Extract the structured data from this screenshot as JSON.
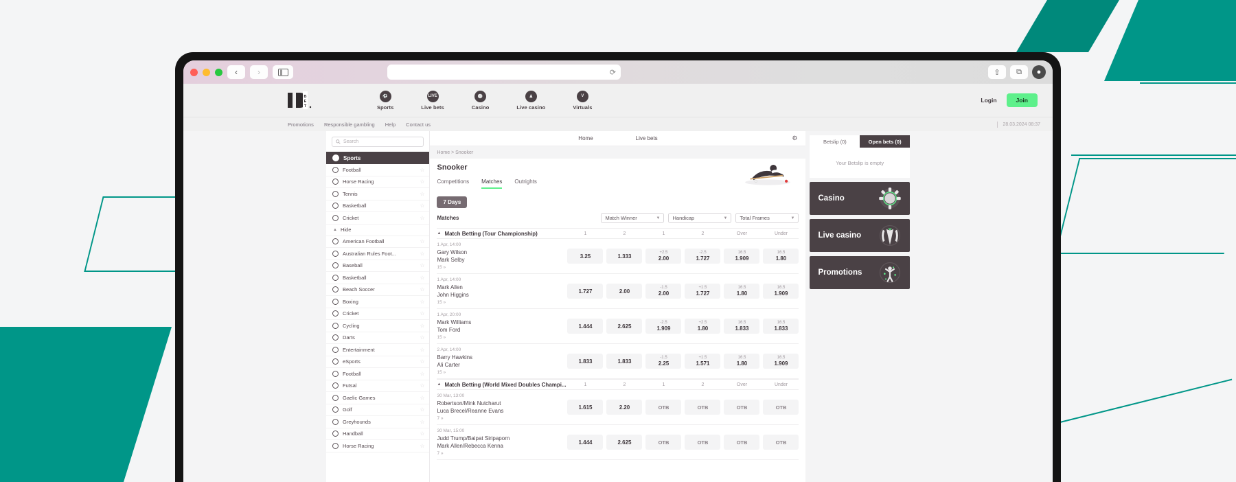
{
  "browser": {
    "back_icon": "‹",
    "forward_icon": "›",
    "sidebar_icon": "sidebar-icon",
    "reload_icon": "⟳",
    "share_icon": "⇧",
    "tabs_icon": "⧉",
    "profile_icon": "●"
  },
  "header": {
    "logo_text": "10BET",
    "nav": [
      {
        "label": "Sports",
        "icon": "football-icon"
      },
      {
        "label": "Live bets",
        "icon": "live-icon"
      },
      {
        "label": "Casino",
        "icon": "chip-icon"
      },
      {
        "label": "Live casino",
        "icon": "dealer-icon"
      },
      {
        "label": "Virtuals",
        "icon": "virtuals-icon"
      }
    ],
    "login_label": "Login",
    "join_label": "Join"
  },
  "subnav": {
    "links": [
      "Promotions",
      "Responsible gambling",
      "Help",
      "Contact us"
    ],
    "datetime": "28.03.2024 08:37"
  },
  "sidebar": {
    "search_placeholder": "Search",
    "section_title": "Sports",
    "top_items": [
      {
        "label": "Football",
        "icon": "football-icon"
      },
      {
        "label": "Horse Racing",
        "icon": "horse-icon"
      },
      {
        "label": "Tennis",
        "icon": "tennis-icon"
      },
      {
        "label": "Basketball",
        "icon": "basketball-icon"
      },
      {
        "label": "Cricket",
        "icon": "cricket-icon"
      }
    ],
    "hide_label": "Hide",
    "all_items": [
      {
        "label": "American Football",
        "icon": "american-football-icon"
      },
      {
        "label": "Australian Rules Foot...",
        "icon": "aussie-rules-icon"
      },
      {
        "label": "Baseball",
        "icon": "baseball-icon"
      },
      {
        "label": "Basketball",
        "icon": "basketball-icon"
      },
      {
        "label": "Beach Soccer",
        "icon": "beach-soccer-icon"
      },
      {
        "label": "Boxing",
        "icon": "boxing-icon"
      },
      {
        "label": "Cricket",
        "icon": "cricket-icon"
      },
      {
        "label": "Cycling",
        "icon": "cycling-icon"
      },
      {
        "label": "Darts",
        "icon": "darts-icon"
      },
      {
        "label": "Entertainment",
        "icon": "tv-icon"
      },
      {
        "label": "eSports",
        "icon": "esports-icon"
      },
      {
        "label": "Football",
        "icon": "football-icon"
      },
      {
        "label": "Futsal",
        "icon": "futsal-icon"
      },
      {
        "label": "Gaelic Games",
        "icon": "gaelic-icon"
      },
      {
        "label": "Golf",
        "icon": "golf-icon"
      },
      {
        "label": "Greyhounds",
        "icon": "greyhound-icon"
      },
      {
        "label": "Handball",
        "icon": "handball-icon"
      },
      {
        "label": "Horse Racing",
        "icon": "horse-icon"
      }
    ],
    "star_icon": "☆"
  },
  "main": {
    "top_tabs": [
      "Home",
      "Live bets"
    ],
    "settings_icon": "gear-icon",
    "breadcrumb": "Home > Snooker",
    "page_title": "Snooker",
    "tabs": [
      {
        "label": "Competitions",
        "active": false
      },
      {
        "label": "Matches",
        "active": true
      },
      {
        "label": "Outrights",
        "active": false
      }
    ],
    "days_filter": "7 Days",
    "matches_label": "Matches",
    "market_selects": [
      "Match Winner",
      "Handicap",
      "Total Frames"
    ],
    "groups": [
      {
        "name": "Match Betting (Tour Championship)",
        "col_headers": [
          "1",
          "2",
          "1",
          "2",
          "Over",
          "Under"
        ],
        "matches": [
          {
            "time": "1 Apr, 14:00",
            "home": "Gary Wilson",
            "away": "Mark Selby",
            "more": "15 »",
            "odds": [
              {
                "hcp": "",
                "val": "3.25"
              },
              {
                "hcp": "",
                "val": "1.333"
              },
              {
                "hcp": "+2.5",
                "val": "2.00"
              },
              {
                "hcp": "-2.5",
                "val": "1.727"
              },
              {
                "hcp": "16.5",
                "val": "1.909"
              },
              {
                "hcp": "16.5",
                "val": "1.80"
              }
            ]
          },
          {
            "time": "1 Apr, 14:00",
            "home": "Mark Allen",
            "away": "John Higgins",
            "more": "15 »",
            "odds": [
              {
                "hcp": "",
                "val": "1.727"
              },
              {
                "hcp": "",
                "val": "2.00"
              },
              {
                "hcp": "-1.5",
                "val": "2.00"
              },
              {
                "hcp": "+1.5",
                "val": "1.727"
              },
              {
                "hcp": "16.5",
                "val": "1.80"
              },
              {
                "hcp": "16.5",
                "val": "1.909"
              }
            ]
          },
          {
            "time": "1 Apr, 20:00",
            "home": "Mark Williams",
            "away": "Tom Ford",
            "more": "15 »",
            "odds": [
              {
                "hcp": "",
                "val": "1.444"
              },
              {
                "hcp": "",
                "val": "2.625"
              },
              {
                "hcp": "-2.5",
                "val": "1.909"
              },
              {
                "hcp": "+2.5",
                "val": "1.80"
              },
              {
                "hcp": "16.5",
                "val": "1.833"
              },
              {
                "hcp": "16.5",
                "val": "1.833"
              }
            ]
          },
          {
            "time": "2 Apr, 14:00",
            "home": "Barry Hawkins",
            "away": "Ali Carter",
            "more": "15 »",
            "odds": [
              {
                "hcp": "",
                "val": "1.833"
              },
              {
                "hcp": "",
                "val": "1.833"
              },
              {
                "hcp": "-1.5",
                "val": "2.25"
              },
              {
                "hcp": "+1.5",
                "val": "1.571"
              },
              {
                "hcp": "16.5",
                "val": "1.80"
              },
              {
                "hcp": "16.5",
                "val": "1.909"
              }
            ]
          }
        ]
      },
      {
        "name": "Match Betting (World Mixed Doubles Champi...",
        "col_headers": [
          "1",
          "2",
          "1",
          "2",
          "Over",
          "Under"
        ],
        "matches": [
          {
            "time": "30 Mar, 13:00",
            "home": "Robertson/Mink Nutcharut",
            "away": "Luca Brecel/Reanne Evans",
            "more": "7 »",
            "odds": [
              {
                "hcp": "",
                "val": "1.615"
              },
              {
                "hcp": "",
                "val": "2.20"
              },
              {
                "hcp": "",
                "val": "OTB"
              },
              {
                "hcp": "",
                "val": "OTB"
              },
              {
                "hcp": "",
                "val": "OTB"
              },
              {
                "hcp": "",
                "val": "OTB"
              }
            ]
          },
          {
            "time": "30 Mar, 15:00",
            "home": "Judd Trump/Baipat Siripaporn",
            "away": "Mark Allen/Rebecca Kenna",
            "more": "7 »",
            "odds": [
              {
                "hcp": "",
                "val": "1.444"
              },
              {
                "hcp": "",
                "val": "2.625"
              },
              {
                "hcp": "",
                "val": "OTB"
              },
              {
                "hcp": "",
                "val": "OTB"
              },
              {
                "hcp": "",
                "val": "OTB"
              },
              {
                "hcp": "",
                "val": "OTB"
              }
            ]
          }
        ]
      }
    ]
  },
  "rail": {
    "betslip_tab": "Betslip (0)",
    "openbets_tab": "Open bets (0)",
    "empty_text": "Your Betslip is empty",
    "promos": [
      {
        "label": "Casino",
        "icon": "chip-icon"
      },
      {
        "label": "Live casino",
        "icon": "dealer-icon"
      },
      {
        "label": "Promotions",
        "icon": "celebrate-icon"
      }
    ]
  },
  "colors": {
    "accent_green": "#5ef08b",
    "dark": "#4a4145",
    "teal": "#009688"
  }
}
